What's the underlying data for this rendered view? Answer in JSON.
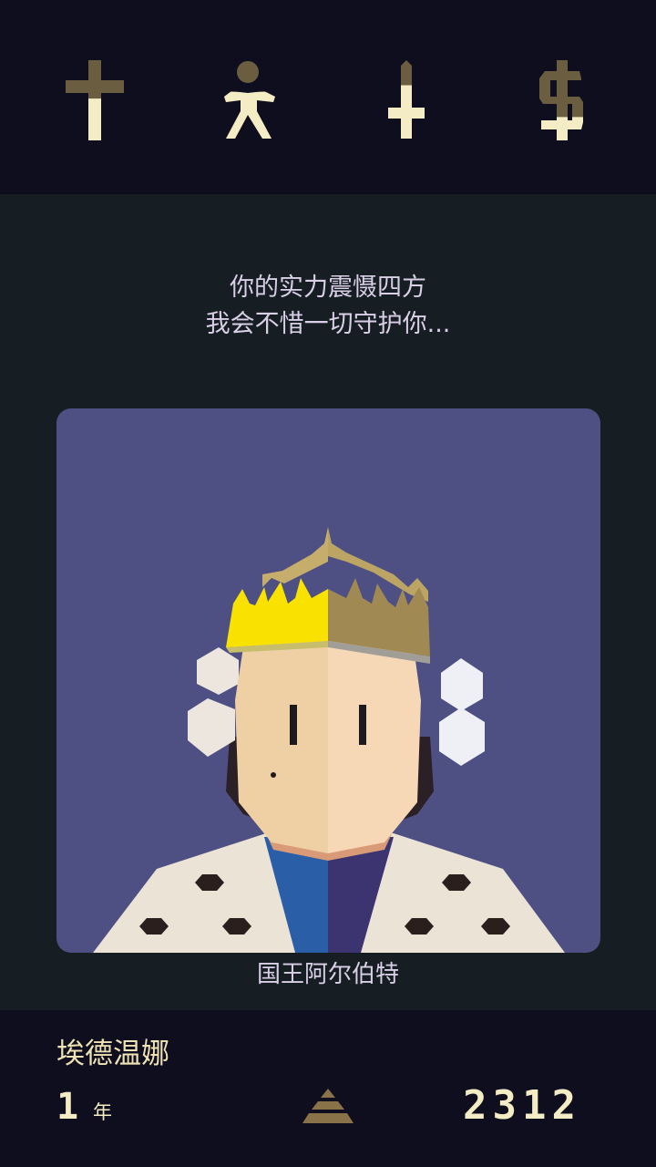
{
  "stats": {
    "religion": {
      "icon": "cross-icon",
      "level": 0.52
    },
    "people": {
      "icon": "person-icon",
      "level": 0.6
    },
    "military": {
      "icon": "sword-icon",
      "level": 0.68
    },
    "money": {
      "icon": "dollar-icon",
      "level": 0.3
    }
  },
  "colors": {
    "stat_filled": "#f4ecc4",
    "stat_empty": "#6b5d3f",
    "card_bg": "#4e5083",
    "text": "#d9cfe6"
  },
  "quote": {
    "line1": "你的实力震慑四方",
    "line2": "我会不惜一切守护你..."
  },
  "character": {
    "name": "国王阿尔伯特"
  },
  "footer": {
    "ruler_name": "埃德温娜",
    "years": "1",
    "years_unit": "年",
    "date": "2312"
  }
}
